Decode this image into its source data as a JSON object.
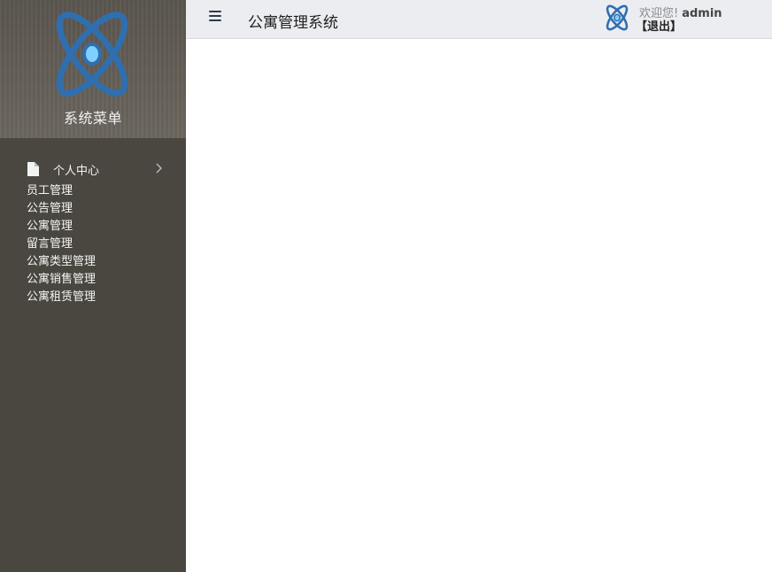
{
  "sidebar": {
    "menu_title": "系统菜单",
    "logo_icon": "atom-logo-icon",
    "root_item": {
      "label": "个人中心",
      "icon": "document-icon"
    },
    "items": [
      {
        "label": "员工管理"
      },
      {
        "label": "公告管理"
      },
      {
        "label": "公寓管理"
      },
      {
        "label": "留言管理"
      },
      {
        "label": "公寓类型管理"
      },
      {
        "label": "公寓销售管理"
      },
      {
        "label": "公寓租赁管理"
      }
    ]
  },
  "header": {
    "title": "公寓管理系统",
    "menu_icon": "hamburger-icon",
    "welcome_text": "欢迎您!",
    "username": "admin",
    "logout_label": "【退出】"
  },
  "colors": {
    "sidebar_bg": "#4a4740",
    "header_bg": "#ecedf1",
    "logo_blue": "#2f6fb0",
    "logo_core": "#7fd0ff"
  }
}
